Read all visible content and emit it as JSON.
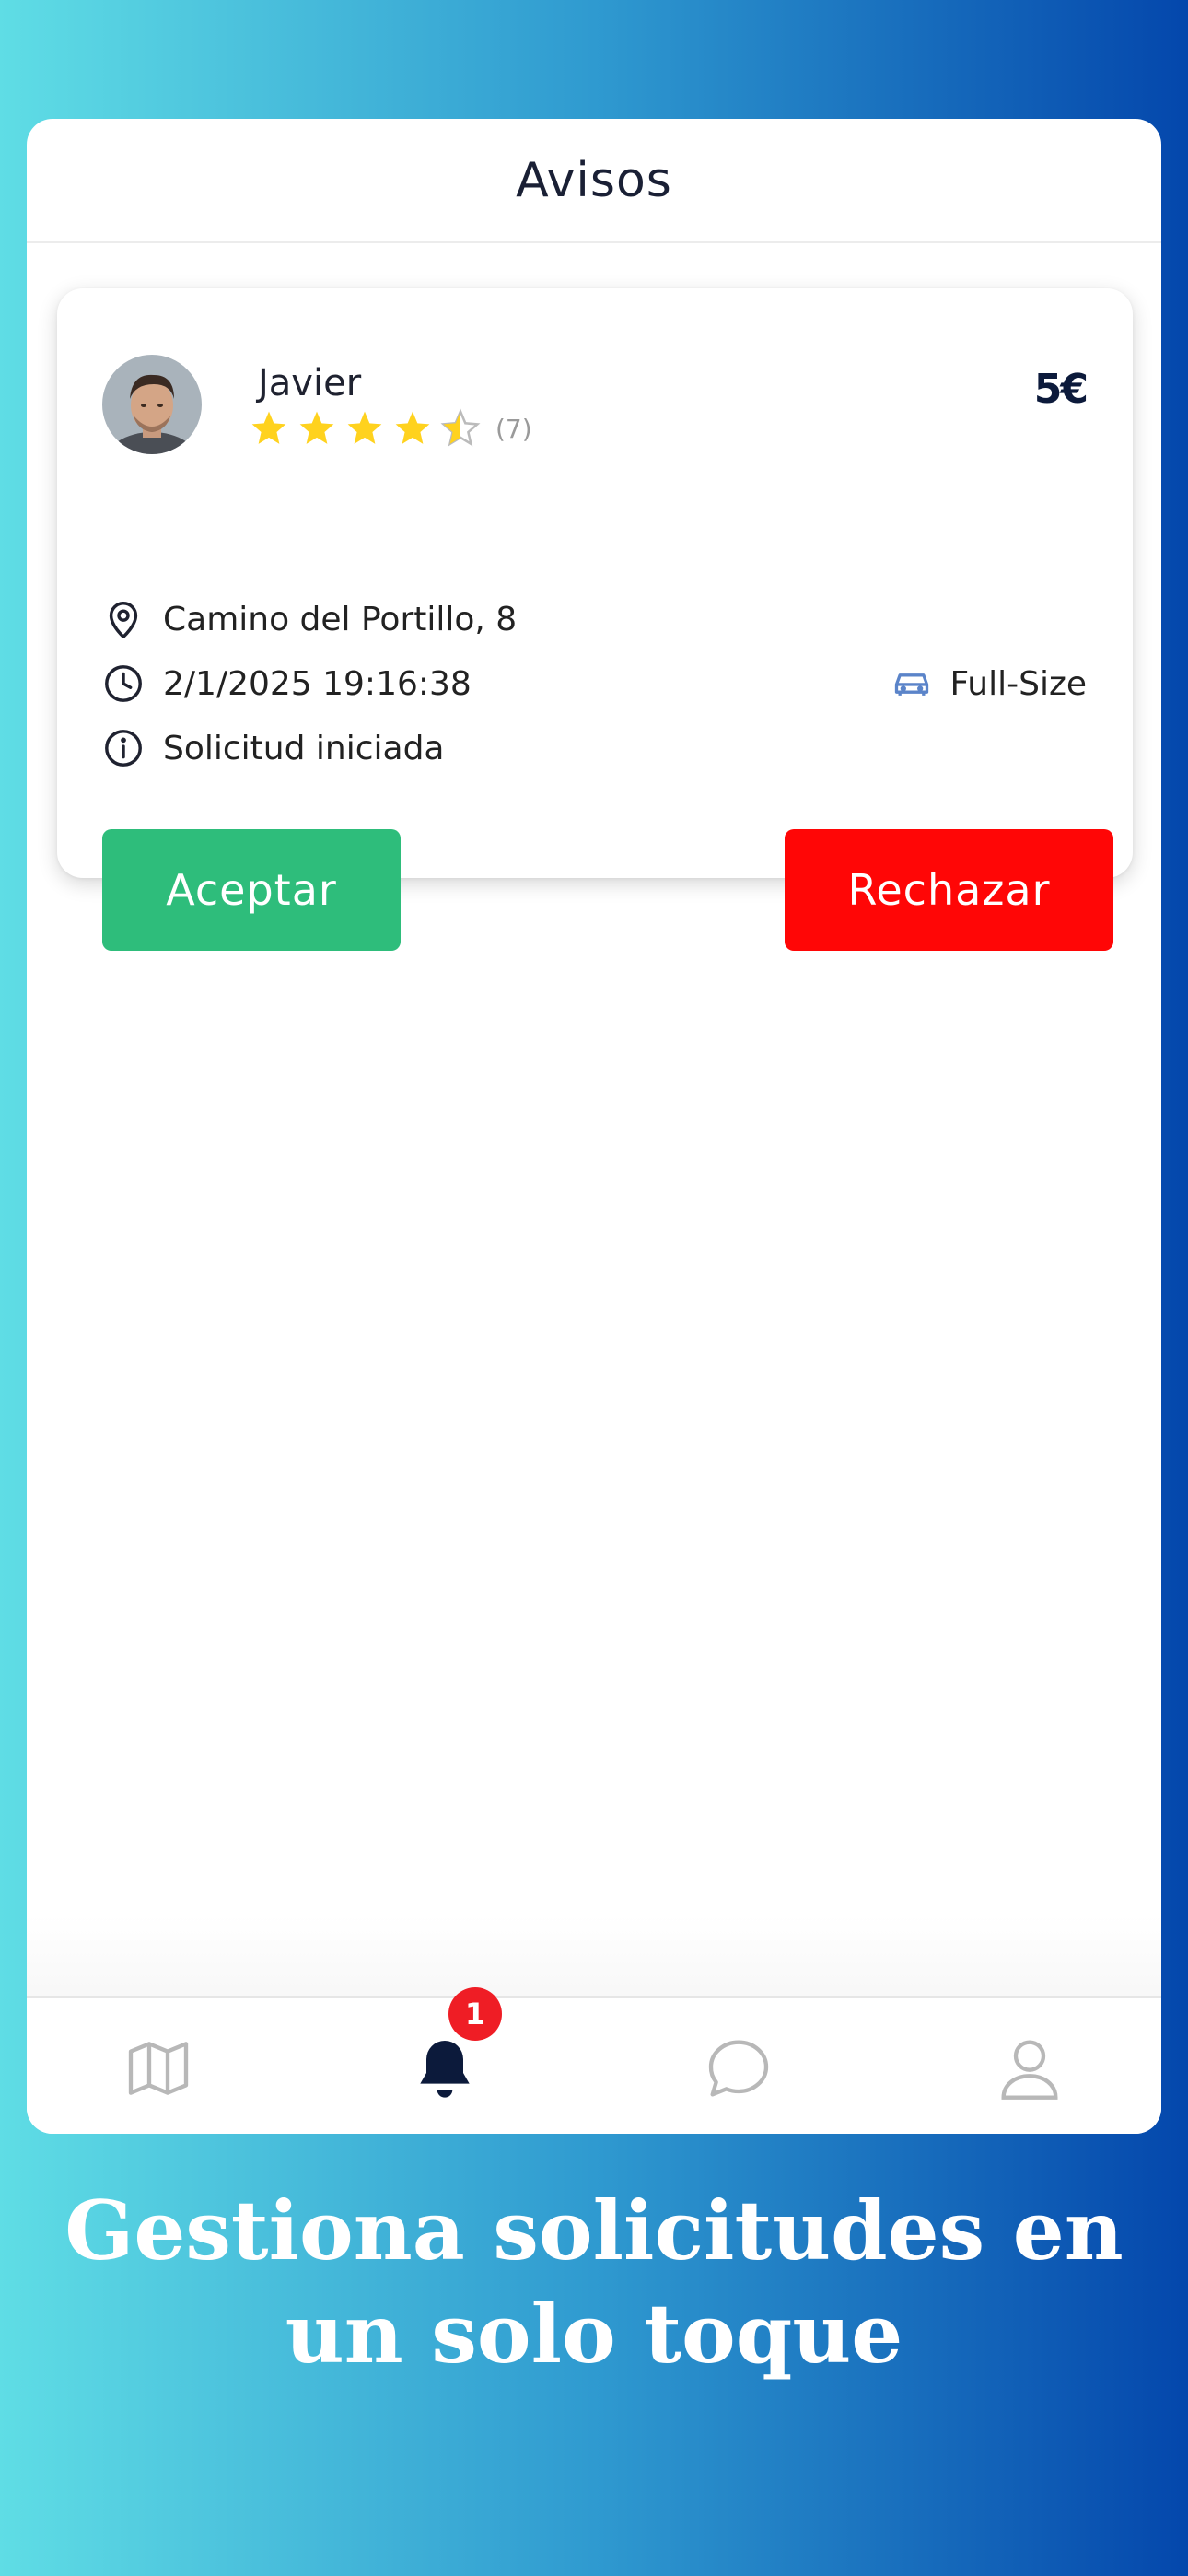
{
  "header": {
    "title": "Avisos"
  },
  "request": {
    "user_name": "Javier",
    "rating": 4.5,
    "review_count": "(7)",
    "price": "5€",
    "address": "Camino del Portillo, 8",
    "datetime": "2/1/2025 19:16:38",
    "vehicle": "Full-Size",
    "status": "Solicitud iniciada",
    "accept_label": "Aceptar",
    "reject_label": "Rechazar"
  },
  "tabs": [
    {
      "icon": "map-icon"
    },
    {
      "icon": "bell-icon",
      "badge": "1",
      "active": true
    },
    {
      "icon": "chat-icon"
    },
    {
      "icon": "user-icon"
    }
  ],
  "colors": {
    "accept": "#2ebd7b",
    "reject": "#ff0606",
    "star": "#ffd21e",
    "badge": "#ef1d25",
    "active_tab": "#0c1a3b"
  },
  "caption": "Gestiona solicitudes en un solo toque"
}
